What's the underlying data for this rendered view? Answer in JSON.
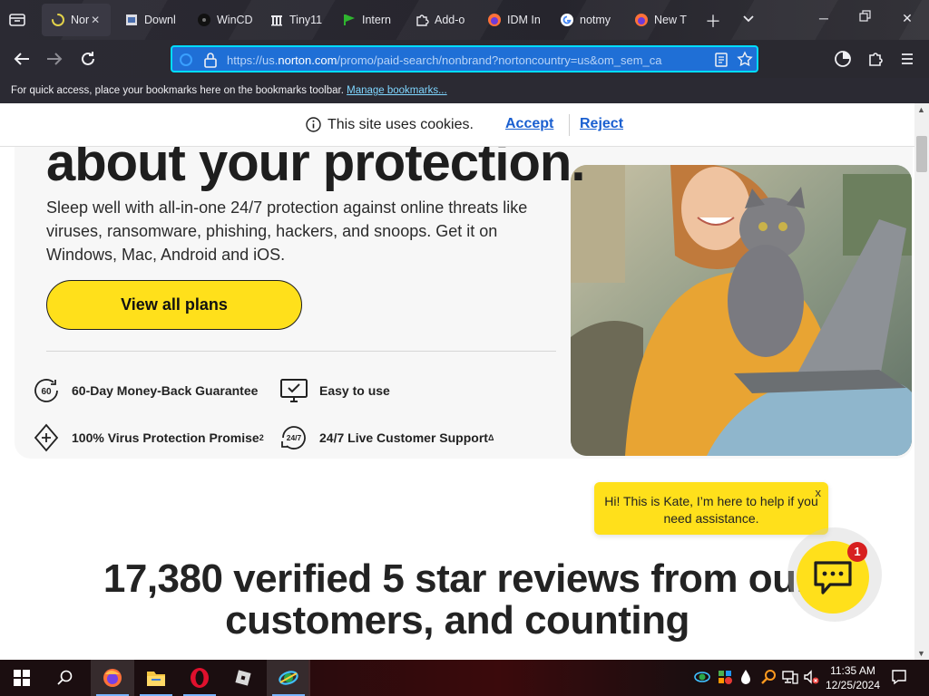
{
  "browser": {
    "tabs": [
      {
        "label": "Nor",
        "active": true,
        "icon": "loading-spinner-icon"
      },
      {
        "label": "Downl",
        "icon": "download-page-icon"
      },
      {
        "label": "WinCD",
        "icon": "wincdemu-icon"
      },
      {
        "label": "Tiny11",
        "icon": "archive-icon"
      },
      {
        "label": "Intern",
        "icon": "green-flag-icon"
      },
      {
        "label": "Add-o",
        "icon": "puzzle-icon"
      },
      {
        "label": "IDM In",
        "icon": "firefox-icon"
      },
      {
        "label": "notmy",
        "icon": "google-icon"
      },
      {
        "label": "New T",
        "icon": "firefox-icon"
      }
    ],
    "tab_close_glyph": "✕",
    "url": {
      "prefix": "https://us.",
      "domain": "norton.com",
      "rest": "/promo/paid-search/nonbrand?nortoncountry=us&om_sem_ca"
    },
    "bookmarks_bar": {
      "text": "For quick access, place your bookmarks here on the bookmarks toolbar.",
      "link": "Manage bookmarks..."
    }
  },
  "cookie_banner": {
    "text": "This site uses cookies.",
    "accept": "Accept",
    "reject": "Reject"
  },
  "hero": {
    "heading_fragment": "about your protection.",
    "description": "Sleep well with all-in-one 24/7 protection against online threats like viruses, ransomware, phishing, hackers, and snoops. Get it on Windows, Mac, Android and iOS.",
    "cta": "View all plans",
    "features": [
      {
        "label": "60-Day Money-Back Guarantee",
        "icon": "sixty-day-icon",
        "icon_text": "60"
      },
      {
        "label": "Easy to use",
        "icon": "monitor-check-icon"
      },
      {
        "label": "100% Virus Protection Promise",
        "sup": "2",
        "icon": "shield-plus-icon"
      },
      {
        "label": "24/7 Live Customer Support",
        "sup": "Δ",
        "icon": "support-24-7-icon",
        "icon_text": "24/7"
      }
    ]
  },
  "reviews": {
    "line1": "17,380 verified 5 star reviews from our",
    "line2": "customers, and counting"
  },
  "chat": {
    "message": "Hi! This is Kate, I’m here to help if you need assistance.",
    "close": "x",
    "badge": "1"
  },
  "taskbar": {
    "apps": [
      "start-icon",
      "search-icon",
      "firefox-icon",
      "file-explorer-icon",
      "opera-icon",
      "roblox-icon",
      "network-app-icon"
    ],
    "time": "11:35 AM",
    "date": "12/25/2024"
  },
  "colors": {
    "accent_yellow": "#ffe01b",
    "link_blue": "#1a5fd0",
    "urlbar_blue": "#1f6fd6"
  }
}
